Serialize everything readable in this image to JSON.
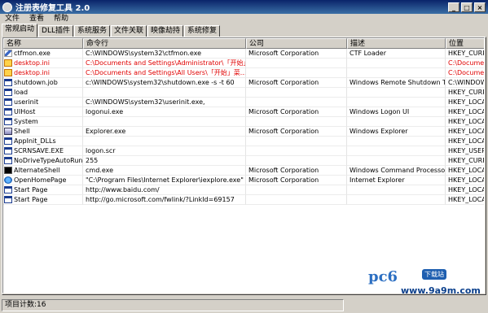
{
  "window": {
    "title": "注册表修复工具 2.0",
    "minimize_glyph": "_",
    "maximize_glyph": "□",
    "close_glyph": "×"
  },
  "menu": [
    "文件",
    "查看",
    "帮助"
  ],
  "tabs": [
    {
      "label": "常规启动",
      "active": true
    },
    {
      "label": "DLL插件"
    },
    {
      "label": "系统服务"
    },
    {
      "label": "文件关联"
    },
    {
      "label": "映像劫持"
    },
    {
      "label": "系统修复"
    }
  ],
  "columns": [
    "名称",
    "命令行",
    "公司",
    "描述",
    "位置"
  ],
  "rows": [
    {
      "icon": "pen-icon",
      "name": "ctfmon.exe",
      "cmd": "C:\\WINDOWS\\system32\\ctfmon.exe",
      "company": "Microsoft Corporation",
      "desc": "CTF Loader",
      "loc": "HKEY_CURR"
    },
    {
      "icon": "config-file-icon",
      "name": "desktop.ini",
      "cmd": "C:\\Documents and Settings\\Administrator\\「开始」...",
      "company": "",
      "desc": "",
      "loc": "C:\\Documen",
      "warn": true
    },
    {
      "icon": "config-file-icon",
      "name": "desktop.ini",
      "cmd": "C:\\Documents and Settings\\All Users\\「开始」菜...",
      "company": "",
      "desc": "",
      "loc": "C:\\Documen",
      "warn": true
    },
    {
      "icon": "app-icon",
      "name": "shutdown.job",
      "cmd": "c:\\WINDOWS\\system32\\shutdown.exe -s -t 60",
      "company": "Microsoft Corporation",
      "desc": "Windows Remote Shutdown T...",
      "loc": "C:\\WINDOW"
    },
    {
      "icon": "app-icon",
      "name": "load",
      "cmd": "",
      "company": "",
      "desc": "",
      "loc": "HKEY_CURR"
    },
    {
      "icon": "app-icon",
      "name": "userinit",
      "cmd": "C:\\WINDOWS\\system32\\userinit.exe,",
      "company": "",
      "desc": "",
      "loc": "HKEY_LOCA"
    },
    {
      "icon": "app-icon",
      "name": "UIHost",
      "cmd": "logonui.exe",
      "company": "Microsoft Corporation",
      "desc": "Windows Logon UI",
      "loc": "HKEY_LOCA"
    },
    {
      "icon": "app-icon",
      "name": "System",
      "cmd": "",
      "company": "",
      "desc": "",
      "loc": "HKEY_LOCA"
    },
    {
      "icon": "shell-icon",
      "name": "Shell",
      "cmd": "Explorer.exe",
      "company": "Microsoft Corporation",
      "desc": "Windows Explorer",
      "loc": "HKEY_LOCA"
    },
    {
      "icon": "app-icon",
      "name": "AppInit_DLLs",
      "cmd": "",
      "company": "",
      "desc": "",
      "loc": "HKEY_LOCA"
    },
    {
      "icon": "app-icon",
      "name": "SCRNSAVE.EXE",
      "cmd": "logon.scr",
      "company": "",
      "desc": "",
      "loc": "HKEY_USER"
    },
    {
      "icon": "app-icon",
      "name": "NoDriveTypeAutoRun",
      "cmd": "255",
      "company": "",
      "desc": "",
      "loc": "HKEY_CURR"
    },
    {
      "icon": "cmd-icon",
      "name": "AlternateShell",
      "cmd": "cmd.exe",
      "company": "Microsoft Corporation",
      "desc": "Windows Command Processor",
      "loc": "HKEY_LOCA"
    },
    {
      "icon": "ie-icon",
      "name": "OpenHomePage",
      "cmd": "\"C:\\Program Files\\Internet Explorer\\iexplore.exe\"",
      "company": "Microsoft Corporation",
      "desc": "Internet Explorer",
      "loc": "HKEY_LOCA"
    },
    {
      "icon": "app-icon",
      "name": "Start Page",
      "cmd": "http://www.baidu.com/",
      "company": "",
      "desc": "",
      "loc": "HKEY_LOCA"
    },
    {
      "icon": "app-icon",
      "name": "Start Page",
      "cmd": "http://go.microsoft.com/fwlink/?LinkId=69157",
      "company": "",
      "desc": "",
      "loc": "HKEY_LOCA"
    }
  ],
  "status": {
    "count_text": "项目计数:16"
  },
  "watermark": {
    "logo": "pc6",
    "badge": "下载站",
    "url": "www.9a9m.com"
  }
}
